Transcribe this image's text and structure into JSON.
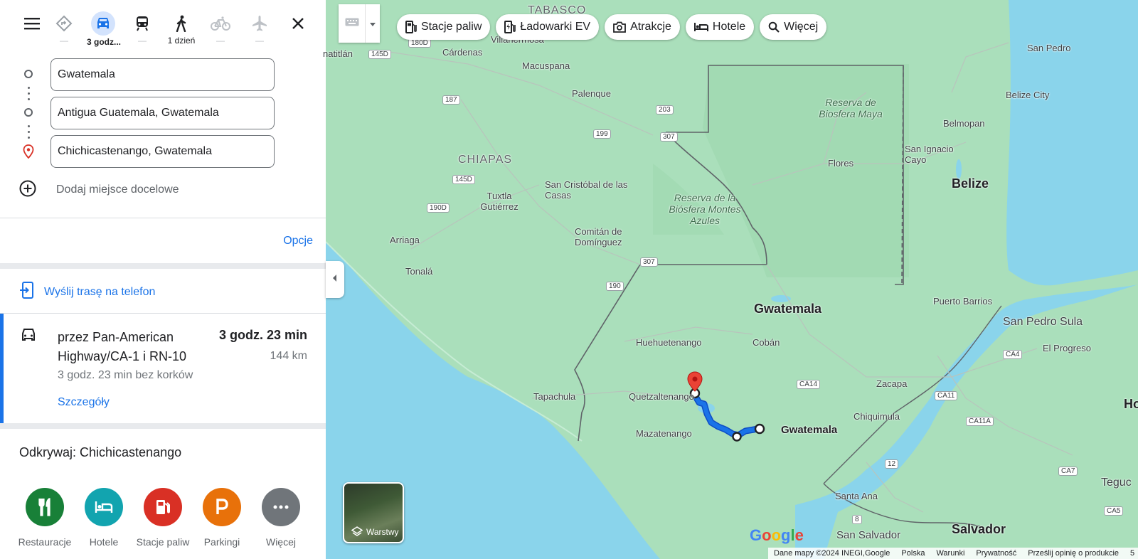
{
  "modes": {
    "car_time": "3 godz...",
    "walk_time": "1 dzień",
    "placeholder_dash": "—"
  },
  "waypoints": [
    "Gwatemala",
    "Antigua Guatemala, Gwatemala",
    "Chichicastenango, Gwatemala"
  ],
  "add_destination": "Dodaj miejsce docelowe",
  "options_label": "Opcje",
  "send_to_phone": "Wyślij trasę na telefon",
  "route": {
    "via": "przez Pan-American Highway/CA-1 i RN-10",
    "duration": "3 godz. 23 min",
    "distance": "144 km",
    "traffic_note": "3 godz. 23 min bez korków",
    "details_link": "Szczegóły"
  },
  "explore": {
    "title": "Odkrywaj: Chichicastenango",
    "categories": [
      {
        "label": "Restauracje",
        "color": "#188038"
      },
      {
        "label": "Hotele",
        "color": "#12a4af"
      },
      {
        "label": "Stacje paliw",
        "color": "#d93025"
      },
      {
        "label": "Parkingi",
        "color": "#e8710a"
      },
      {
        "label": "Więcej",
        "color": "#70757a"
      }
    ]
  },
  "chips": [
    "Stacje paliw",
    "Ładowarki EV",
    "Atrakcje",
    "Hotele",
    "Więcej"
  ],
  "layers_label": "Warstwy",
  "map_labels": {
    "tabasco": "TABASCO",
    "villahermosa": "Villahermosa",
    "cardenas": "Cárdenas",
    "natitlan": "natitlán",
    "macuspana": "Macuspana",
    "palenque": "Palenque",
    "san_pedro": "San Pedro",
    "belize_city": "Belize City",
    "belmopan": "Belmopan",
    "san_ignacio": "San Ignacio Cayo",
    "belize": "Belize",
    "maya": "Reserva de Biosfera Maya",
    "flores": "Flores",
    "chiapas": "CHIAPAS",
    "san_cristobal": "San Cristóbal de las Casas",
    "tuxtla": "Tuxtla Gutiérrez",
    "montes_azules": "Reserva de la Biósfera Montes Azules",
    "arriaga": "Arriaga",
    "comitan": "Comitán de Domínguez",
    "tonala": "Tonalá",
    "puerto_barrios": "Puerto Barrios",
    "san_pedro_sula": "San Pedro Sula",
    "el_progreso": "El Progreso",
    "guatemala_country": "Gwatemala",
    "huehuetenango": "Huehuetenango",
    "coban": "Cobán",
    "tapachula": "Tapachula",
    "quetzaltenango": "Quetzaltenango",
    "zacapa": "Zacapa",
    "chiquimula": "Chiquimula",
    "mazatenango": "Mazatenango",
    "guatemala_city": "Gwatemala",
    "santa_ana": "Santa Ana",
    "san_salvador": "San Salvador",
    "salvador": "Salvador",
    "tegucigalpa": "Teguc",
    "honduras": "Ho"
  },
  "shields": [
    "145D",
    "180D",
    "187",
    "203",
    "199",
    "307",
    "145D",
    "190D",
    "307",
    "190",
    "CA14",
    "CA4",
    "CA11",
    "CA11A",
    "12",
    "8",
    "CA7",
    "CA5"
  ],
  "google_logo": "Google",
  "footer": {
    "data": "Dane mapy ©2024 INEGI,Google",
    "country": "Polska",
    "terms": "Warunki",
    "privacy": "Prywatność",
    "feedback": "Prześlij opinię o produkcie",
    "scale": "5"
  },
  "colors": {
    "accent": "#1a73e8",
    "route": "#1a73e8",
    "water": "#8ad4eb",
    "land": "#aadfbb",
    "pin": "#ea4335"
  }
}
